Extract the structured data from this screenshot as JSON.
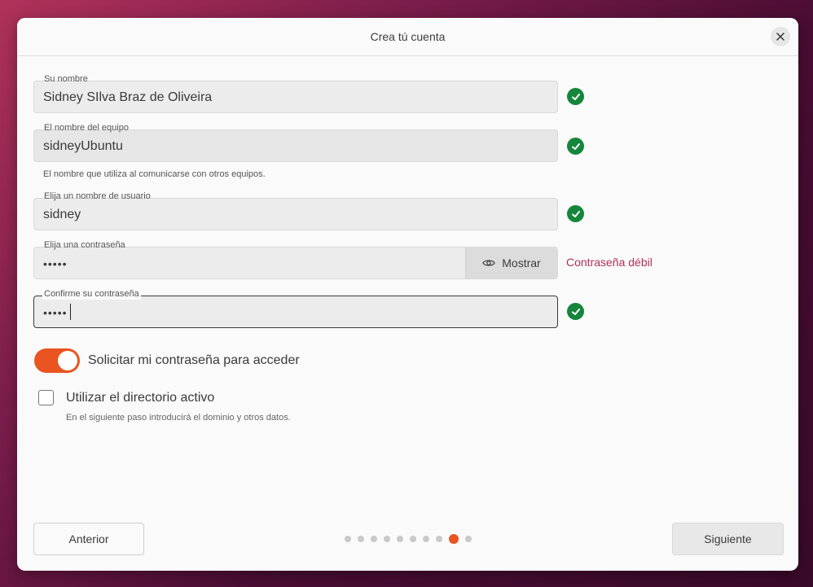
{
  "window": {
    "title": "Crea tú cuenta",
    "close_icon": "close-icon"
  },
  "form": {
    "name": {
      "label": "Su nombre",
      "value": "Sidney SIlva Braz de Oliveira",
      "valid": true
    },
    "computer_name": {
      "label": "El nombre del equipo",
      "value": "sidneyUbuntu",
      "hint": "El nombre que utiliza al comunicarse con otros equipos.",
      "valid": true
    },
    "username": {
      "label": "Elija un nombre de usuario",
      "value": "sidney",
      "valid": true
    },
    "password": {
      "label": "Elija una contraseña",
      "value": "•••••",
      "show_label": "Mostrar",
      "show_icon": "eye-icon",
      "strength": "Contraseña débil"
    },
    "confirm_password": {
      "label": "Confirme su contraseña",
      "value": "•••••",
      "valid": true
    }
  },
  "options": {
    "require_password": {
      "label": "Solicitar mi contraseña para acceder",
      "enabled": true
    },
    "active_directory": {
      "label": "Utilizar el directorio activo",
      "hint": "En el siguiente paso introducirá el dominio y otros datos.",
      "checked": false
    }
  },
  "nav": {
    "previous_label": "Anterior",
    "next_label": "Siguiente",
    "steps_total": 10,
    "current_step": 9
  },
  "colors": {
    "accent": "#e95420",
    "success": "#16863c",
    "warning_text": "#b0315a"
  }
}
